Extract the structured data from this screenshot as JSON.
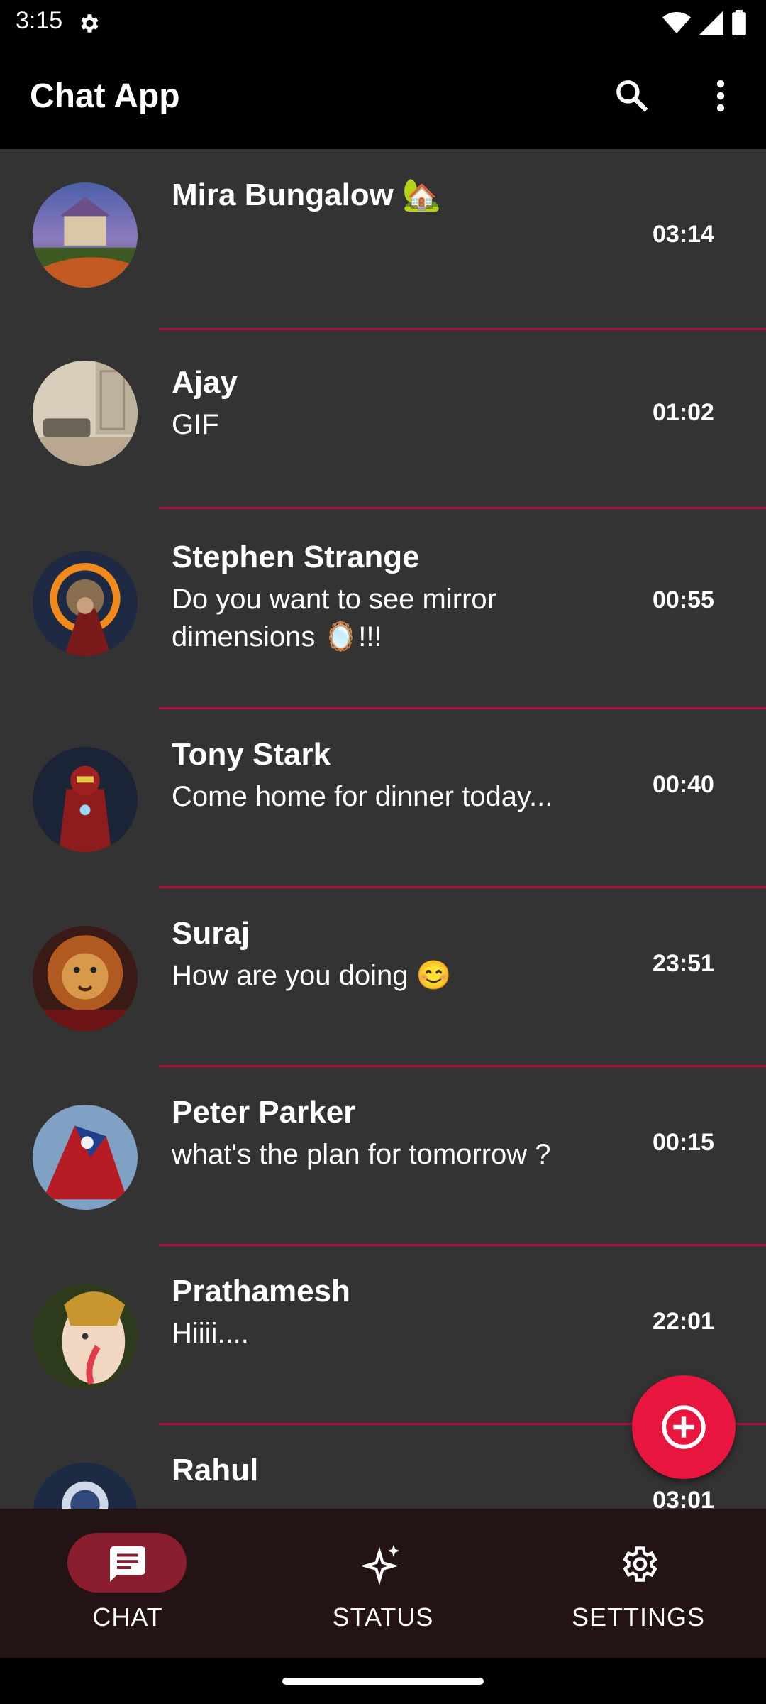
{
  "status_bar": {
    "time": "3:15",
    "icons": [
      "settings-gear-icon",
      "wifi-icon",
      "cellular-signal-icon",
      "battery-icon"
    ]
  },
  "app_bar": {
    "title": "Chat App",
    "actions": [
      "search-icon",
      "more-vert-icon"
    ]
  },
  "chats": [
    {
      "name": "Mira Bungalow 🏡",
      "message": "",
      "time": "03:14"
    },
    {
      "name": "Ajay",
      "message": "GIF",
      "time": "01:02"
    },
    {
      "name": "Stephen Strange",
      "message": "Do you want to see mirror dimensions 🪞!!!",
      "time": "00:55"
    },
    {
      "name": "Tony Stark",
      "message": "Come home for dinner today...",
      "time": "00:40"
    },
    {
      "name": "Suraj",
      "message": "How are you doing 😊",
      "time": "23:51"
    },
    {
      "name": "Peter Parker",
      "message": "what's the plan for tomorrow ?",
      "time": "00:15"
    },
    {
      "name": "Prathamesh",
      "message": "Hiiii....",
      "time": "22:01"
    },
    {
      "name": "Rahul",
      "message": "",
      "time": "03:01"
    }
  ],
  "fab": {
    "icon": "add-circle-icon"
  },
  "bottom_nav": [
    {
      "label": "CHAT",
      "icon": "chat-bubble-icon",
      "selected": true
    },
    {
      "label": "STATUS",
      "icon": "sparkle-icon",
      "selected": false
    },
    {
      "label": "SETTINGS",
      "icon": "settings-icon",
      "selected": false
    }
  ],
  "colors": {
    "accent": "#e8163f",
    "divider": "#b0103a",
    "list_bg": "#333333",
    "nav_bg": "#231315",
    "pill": "#8a1d2e"
  }
}
